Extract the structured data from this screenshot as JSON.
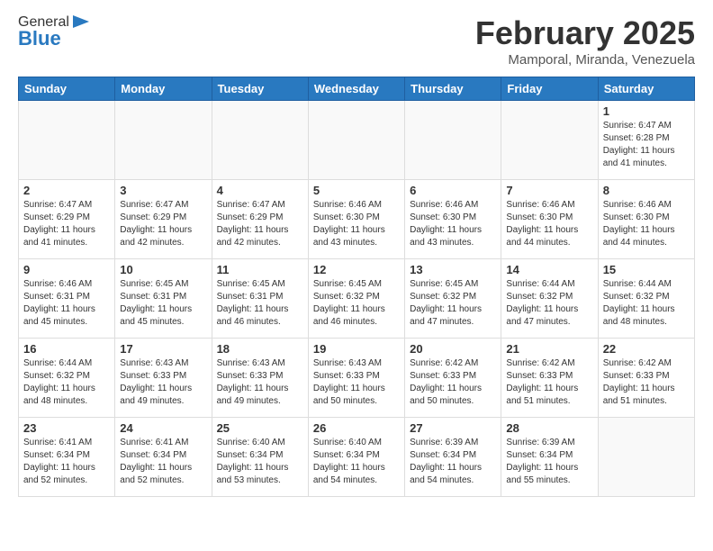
{
  "header": {
    "logo_general": "General",
    "logo_blue": "Blue",
    "title": "February 2025",
    "subtitle": "Mamporal, Miranda, Venezuela"
  },
  "days_of_week": [
    "Sunday",
    "Monday",
    "Tuesday",
    "Wednesday",
    "Thursday",
    "Friday",
    "Saturday"
  ],
  "weeks": [
    [
      {
        "day": "",
        "info": ""
      },
      {
        "day": "",
        "info": ""
      },
      {
        "day": "",
        "info": ""
      },
      {
        "day": "",
        "info": ""
      },
      {
        "day": "",
        "info": ""
      },
      {
        "day": "",
        "info": ""
      },
      {
        "day": "1",
        "info": "Sunrise: 6:47 AM\nSunset: 6:28 PM\nDaylight: 11 hours and 41 minutes."
      }
    ],
    [
      {
        "day": "2",
        "info": "Sunrise: 6:47 AM\nSunset: 6:29 PM\nDaylight: 11 hours and 41 minutes."
      },
      {
        "day": "3",
        "info": "Sunrise: 6:47 AM\nSunset: 6:29 PM\nDaylight: 11 hours and 42 minutes."
      },
      {
        "day": "4",
        "info": "Sunrise: 6:47 AM\nSunset: 6:29 PM\nDaylight: 11 hours and 42 minutes."
      },
      {
        "day": "5",
        "info": "Sunrise: 6:46 AM\nSunset: 6:30 PM\nDaylight: 11 hours and 43 minutes."
      },
      {
        "day": "6",
        "info": "Sunrise: 6:46 AM\nSunset: 6:30 PM\nDaylight: 11 hours and 43 minutes."
      },
      {
        "day": "7",
        "info": "Sunrise: 6:46 AM\nSunset: 6:30 PM\nDaylight: 11 hours and 44 minutes."
      },
      {
        "day": "8",
        "info": "Sunrise: 6:46 AM\nSunset: 6:30 PM\nDaylight: 11 hours and 44 minutes."
      }
    ],
    [
      {
        "day": "9",
        "info": "Sunrise: 6:46 AM\nSunset: 6:31 PM\nDaylight: 11 hours and 45 minutes."
      },
      {
        "day": "10",
        "info": "Sunrise: 6:45 AM\nSunset: 6:31 PM\nDaylight: 11 hours and 45 minutes."
      },
      {
        "day": "11",
        "info": "Sunrise: 6:45 AM\nSunset: 6:31 PM\nDaylight: 11 hours and 46 minutes."
      },
      {
        "day": "12",
        "info": "Sunrise: 6:45 AM\nSunset: 6:32 PM\nDaylight: 11 hours and 46 minutes."
      },
      {
        "day": "13",
        "info": "Sunrise: 6:45 AM\nSunset: 6:32 PM\nDaylight: 11 hours and 47 minutes."
      },
      {
        "day": "14",
        "info": "Sunrise: 6:44 AM\nSunset: 6:32 PM\nDaylight: 11 hours and 47 minutes."
      },
      {
        "day": "15",
        "info": "Sunrise: 6:44 AM\nSunset: 6:32 PM\nDaylight: 11 hours and 48 minutes."
      }
    ],
    [
      {
        "day": "16",
        "info": "Sunrise: 6:44 AM\nSunset: 6:32 PM\nDaylight: 11 hours and 48 minutes."
      },
      {
        "day": "17",
        "info": "Sunrise: 6:43 AM\nSunset: 6:33 PM\nDaylight: 11 hours and 49 minutes."
      },
      {
        "day": "18",
        "info": "Sunrise: 6:43 AM\nSunset: 6:33 PM\nDaylight: 11 hours and 49 minutes."
      },
      {
        "day": "19",
        "info": "Sunrise: 6:43 AM\nSunset: 6:33 PM\nDaylight: 11 hours and 50 minutes."
      },
      {
        "day": "20",
        "info": "Sunrise: 6:42 AM\nSunset: 6:33 PM\nDaylight: 11 hours and 50 minutes."
      },
      {
        "day": "21",
        "info": "Sunrise: 6:42 AM\nSunset: 6:33 PM\nDaylight: 11 hours and 51 minutes."
      },
      {
        "day": "22",
        "info": "Sunrise: 6:42 AM\nSunset: 6:33 PM\nDaylight: 11 hours and 51 minutes."
      }
    ],
    [
      {
        "day": "23",
        "info": "Sunrise: 6:41 AM\nSunset: 6:34 PM\nDaylight: 11 hours and 52 minutes."
      },
      {
        "day": "24",
        "info": "Sunrise: 6:41 AM\nSunset: 6:34 PM\nDaylight: 11 hours and 52 minutes."
      },
      {
        "day": "25",
        "info": "Sunrise: 6:40 AM\nSunset: 6:34 PM\nDaylight: 11 hours and 53 minutes."
      },
      {
        "day": "26",
        "info": "Sunrise: 6:40 AM\nSunset: 6:34 PM\nDaylight: 11 hours and 54 minutes."
      },
      {
        "day": "27",
        "info": "Sunrise: 6:39 AM\nSunset: 6:34 PM\nDaylight: 11 hours and 54 minutes."
      },
      {
        "day": "28",
        "info": "Sunrise: 6:39 AM\nSunset: 6:34 PM\nDaylight: 11 hours and 55 minutes."
      },
      {
        "day": "",
        "info": ""
      }
    ]
  ]
}
